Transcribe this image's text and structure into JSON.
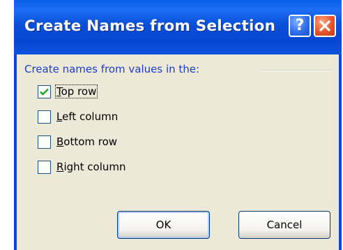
{
  "window": {
    "title": "Create Names from Selection",
    "help_label": "?",
    "colors": {
      "titlebar": "#0a4fd8",
      "frame": "#0a47d6",
      "body": "#ece9d8",
      "group_label": "#1c3cc8"
    }
  },
  "group": {
    "label": "Create names from values in the:"
  },
  "options": [
    {
      "label_pre": "",
      "accel": "T",
      "label_post": "op row",
      "checked": true
    },
    {
      "label_pre": "",
      "accel": "L",
      "label_post": "eft column",
      "checked": false
    },
    {
      "label_pre": "",
      "accel": "B",
      "label_post": "ottom row",
      "checked": false
    },
    {
      "label_pre": "",
      "accel": "R",
      "label_post": "ight column",
      "checked": false
    }
  ],
  "buttons": {
    "ok_label": "OK",
    "cancel_label": "Cancel"
  },
  "icons": {
    "help": "help-icon",
    "close": "close-icon",
    "checkmark": "checkmark-icon"
  }
}
